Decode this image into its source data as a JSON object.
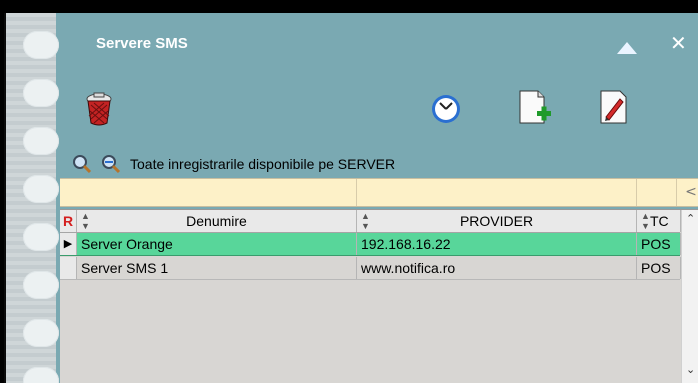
{
  "window": {
    "title": "Servere SMS"
  },
  "filter": {
    "label": "Toate inregistrarile disponibile pe SERVER"
  },
  "grid": {
    "indicator_header": "R",
    "columns": [
      "Denumire",
      "PROVIDER",
      "TC"
    ],
    "rows": [
      {
        "denumire": "Server Orange",
        "provider": "192.168.16.22",
        "tc": "POS",
        "selected": true
      },
      {
        "denumire": "Server SMS 1",
        "provider": "www.notifica.ro",
        "tc": "POS",
        "selected": false
      }
    ]
  },
  "colors": {
    "panel_bg": "#7aa9b2",
    "search_strip": "#fdf1c8",
    "selected_row": "#58d69a",
    "row_bg": "#d8d6d3"
  },
  "icons": [
    "trash-icon",
    "clock-icon",
    "add-document-icon",
    "edit-document-icon",
    "search-icon",
    "search-all-icon",
    "collapse-up-icon",
    "close-icon",
    "scroll-left-icon",
    "scroll-up-icon",
    "scroll-down-icon",
    "row-pointer-icon",
    "sort-icon"
  ]
}
